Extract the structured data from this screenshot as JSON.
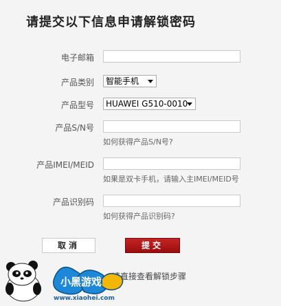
{
  "title": "请提交以下信息申请解锁密码",
  "form": {
    "email": {
      "label": "电子邮箱",
      "value": ""
    },
    "category": {
      "label": "产品类别",
      "value": "智能手机"
    },
    "model": {
      "label": "产品型号",
      "value": "HUAWEI G510-0010"
    },
    "sn": {
      "label": "产品S/N号",
      "value": "",
      "hint": "如何获得产品S/N号?"
    },
    "imei": {
      "label": "产品IMEI/MEID",
      "value": "",
      "hint": "如果是双卡手机，请输入主IMEI/MEID号"
    },
    "product_id": {
      "label": "产品识别码",
      "value": "",
      "hint": "如何获得产品识别码?"
    }
  },
  "buttons": {
    "cancel": "取消",
    "submit": "提交"
  },
  "help_link": "请直接查看解锁步骤",
  "watermark": {
    "text": "www.xiaohei.com",
    "brand": "小黑游戏"
  }
}
